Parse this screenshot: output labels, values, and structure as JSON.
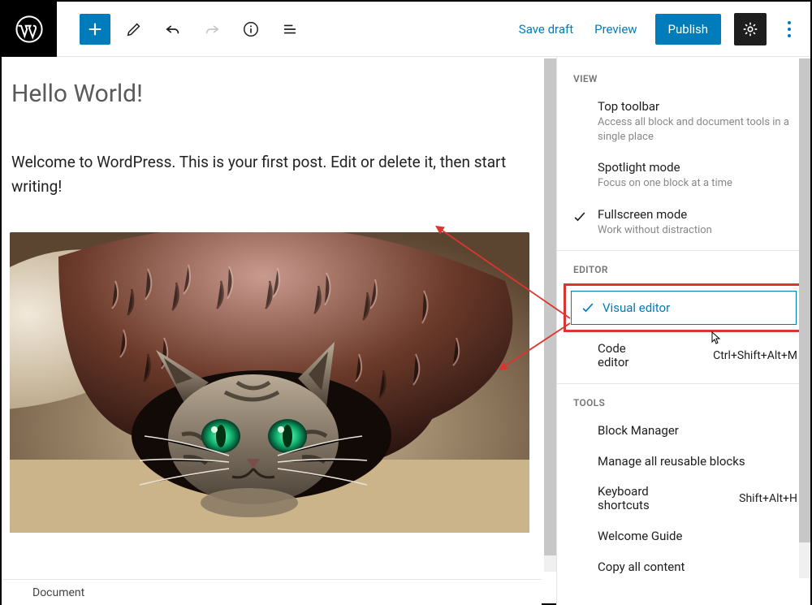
{
  "toolbar": {
    "save_draft": "Save draft",
    "preview": "Preview",
    "publish": "Publish"
  },
  "post": {
    "title": "Hello World!",
    "paragraph": "Welcome to WordPress. This is your first post. Edit or delete it, then start writing!"
  },
  "footer": {
    "document_tab": "Document"
  },
  "panel": {
    "sections": {
      "view": "VIEW",
      "editor": "EDITOR",
      "tools": "TOOLS"
    },
    "view_items": [
      {
        "title": "Top toolbar",
        "desc": "Access all block and document tools in a single place",
        "checked": false
      },
      {
        "title": "Spotlight mode",
        "desc": "Focus on one block at a time",
        "checked": false
      },
      {
        "title": "Fullscreen mode",
        "desc": "Work without distraction",
        "checked": true
      }
    ],
    "editor_items": {
      "visual": "Visual editor",
      "code": {
        "label": "Code editor",
        "shortcut": "Ctrl+Shift+Alt+M"
      }
    },
    "tools_items": [
      {
        "label": "Block Manager",
        "shortcut": ""
      },
      {
        "label": "Manage all reusable blocks",
        "shortcut": ""
      },
      {
        "label": "Keyboard shortcuts",
        "shortcut": "Shift+Alt+H"
      },
      {
        "label": "Welcome Guide",
        "shortcut": ""
      },
      {
        "label": "Copy all content",
        "shortcut": ""
      }
    ]
  }
}
